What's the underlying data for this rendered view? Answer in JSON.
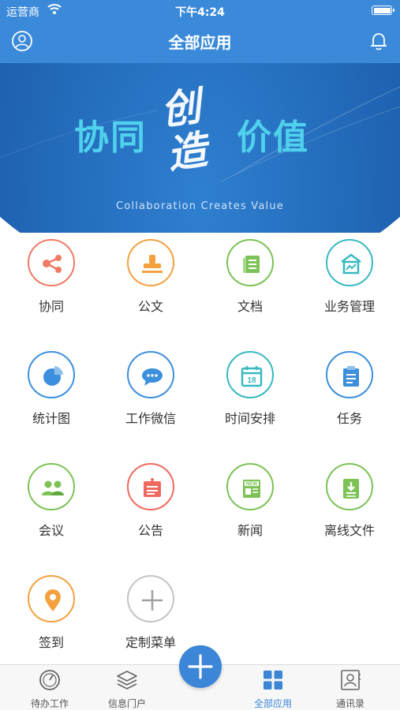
{
  "status": {
    "carrier": "运营商",
    "time": "下午4:24"
  },
  "nav": {
    "title": "全部应用",
    "left_icon": "user-icon",
    "right_icon": "bell-icon"
  },
  "banner": {
    "left": "协同",
    "mid_calligraphy": "创造",
    "right": "价值",
    "subtitle": "Collaboration Creates Value"
  },
  "apps": [
    {
      "label": "协同",
      "icon": "share-icon",
      "color": "#ef7a65"
    },
    {
      "label": "公文",
      "icon": "stamp-icon",
      "color": "#f3a13f"
    },
    {
      "label": "文档",
      "icon": "document-icon",
      "color": "#7cc256"
    },
    {
      "label": "业务管理",
      "icon": "business-chart-icon",
      "color": "#37b9c0"
    },
    {
      "label": "统计图",
      "icon": "pie-chart-icon",
      "color": "#3c8fdc"
    },
    {
      "label": "工作微信",
      "icon": "chat-icon",
      "color": "#3c8fdc"
    },
    {
      "label": "时间安排",
      "icon": "calendar-icon",
      "color": "#37b9c0"
    },
    {
      "label": "任务",
      "icon": "clipboard-icon",
      "color": "#3c8fdc"
    },
    {
      "label": "会议",
      "icon": "people-icon",
      "color": "#7cc256"
    },
    {
      "label": "公告",
      "icon": "bulletin-icon",
      "color": "#ef6a5e"
    },
    {
      "label": "新闻",
      "icon": "newspaper-icon",
      "color": "#7cc256"
    },
    {
      "label": "离线文件",
      "icon": "download-file-icon",
      "color": "#7cc256"
    },
    {
      "label": "签到",
      "icon": "location-pin-icon",
      "color": "#f3a13f"
    },
    {
      "label": "定制菜单",
      "icon": "plus-icon",
      "color": "#b0b0b0"
    }
  ],
  "tabs": [
    {
      "label": "待办工作",
      "icon": "gauge-icon"
    },
    {
      "label": "信息门户",
      "icon": "layers-icon"
    },
    {
      "label": "全部应用",
      "icon": "grid-icon",
      "active": true
    },
    {
      "label": "通讯录",
      "icon": "contacts-icon"
    }
  ],
  "fab": {
    "icon": "plus-icon"
  }
}
